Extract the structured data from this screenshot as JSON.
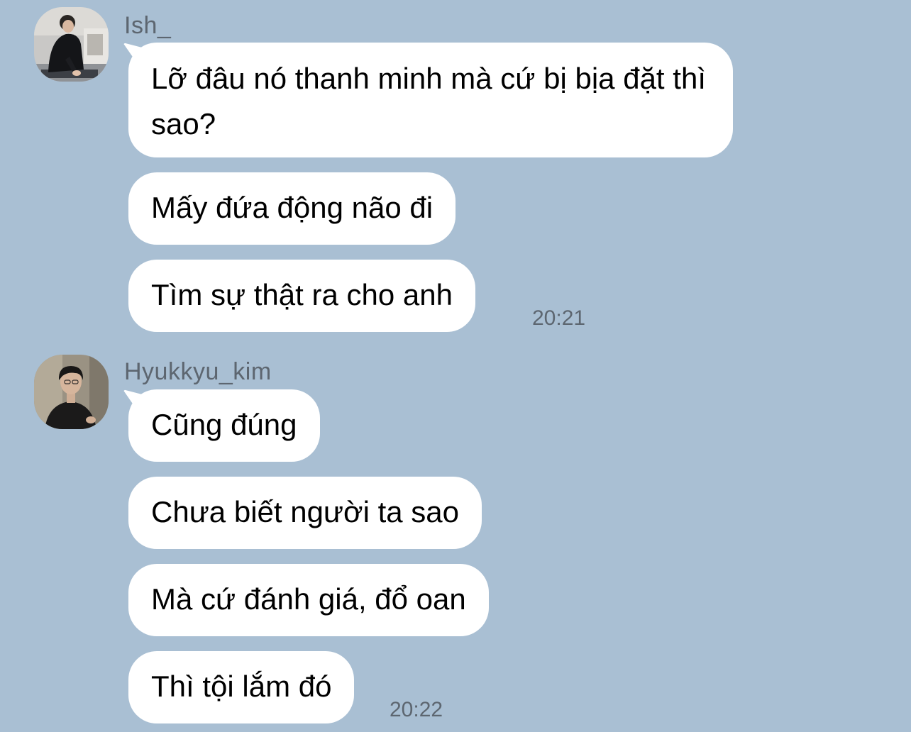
{
  "chat": {
    "groups": [
      {
        "sender": "Ish_",
        "messages": [
          "Lỡ đâu nó thanh minh mà cứ bị bịa đặt thì sao?",
          "Mấy đứa động não đi",
          "Tìm sự thật ra cho anh"
        ],
        "time": "20:21"
      },
      {
        "sender": "Hyukkyu_kim",
        "messages": [
          "Cũng đúng",
          "Chưa biết người ta sao",
          "Mà cứ đánh giá, đổ oan",
          "Thì tội lắm đó"
        ],
        "time": "20:22"
      }
    ]
  },
  "colors": {
    "background": "#a9bfd3",
    "bubble": "#ffffff",
    "meta_text": "#5d6670"
  }
}
